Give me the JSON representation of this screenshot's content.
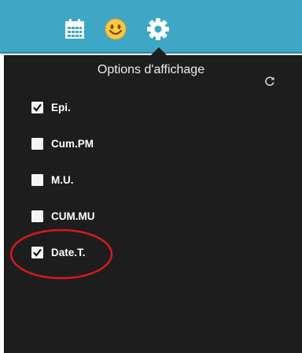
{
  "toolbar": {
    "icons": [
      "calendar-icon",
      "smiley-icon",
      "gear-icon"
    ],
    "background_color": "#3ea7c6"
  },
  "panel": {
    "title": "Options d'affichage",
    "refresh_icon": "refresh-icon",
    "background_color": "#1d1d1d",
    "options": [
      {
        "label": "Epi.",
        "checked": true
      },
      {
        "label": "Cum.PM",
        "checked": false
      },
      {
        "label": "M.U.",
        "checked": false
      },
      {
        "label": "CUM.MU",
        "checked": false
      },
      {
        "label": "Date.T.",
        "checked": true
      }
    ]
  },
  "annotation": {
    "shape": "ellipse",
    "color": "#d7191c"
  }
}
